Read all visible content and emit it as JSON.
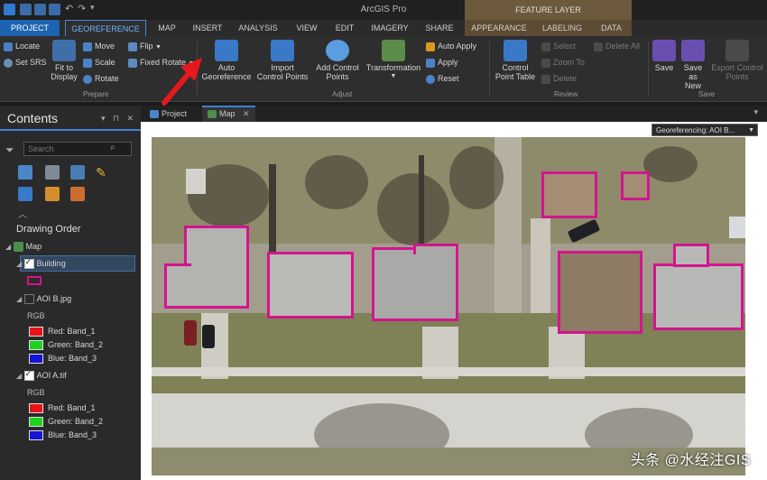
{
  "title_bar": {
    "app_title": "ArcGIS Pro",
    "context_header": "FEATURE LAYER"
  },
  "ribbon_tabs": [
    "PROJECT",
    "GEOREFERENCE",
    "MAP",
    "INSERT",
    "ANALYSIS",
    "VIEW",
    "EDIT",
    "IMAGERY",
    "SHARE",
    "APPEARANCE",
    "LABELING",
    "DATA"
  ],
  "ribbon": {
    "prepare": {
      "locate": "Locate",
      "set_srs": "Set SRS",
      "fit_to_display_l1": "Fit to",
      "fit_to_display_l2": "Display",
      "move": "Move",
      "scale": "Scale",
      "rotate": "Rotate",
      "flip": "Flip",
      "fixed_rotate": "Fixed Rotate",
      "group_label": "Prepare"
    },
    "adjust": {
      "auto_georeference_l1": "Auto",
      "auto_georeference_l2": "Georeference",
      "import_cp_l1": "Import",
      "import_cp_l2": "Control Points",
      "add_cp_l1": "Add Control",
      "add_cp_l2": "Points",
      "transformation": "Transformation",
      "auto_apply": "Auto Apply",
      "apply": "Apply",
      "reset": "Reset",
      "group_label": "Adjust"
    },
    "review": {
      "cp_table_l1": "Control",
      "cp_table_l2": "Point Table",
      "select": "Select",
      "zoom_to": "Zoom To",
      "delete": "Delete",
      "delete_all": "Delete All",
      "group_label": "Review"
    },
    "save": {
      "save": "Save",
      "save_as_new_l1": "Save as",
      "save_as_new_l2": "New",
      "export_cp_l1": "Export Control",
      "export_cp_l2": "Points",
      "group_label": "Save"
    }
  },
  "contents": {
    "title": "Contents",
    "search_placeholder": "Search",
    "drawing_order": "Drawing Order",
    "tree": {
      "map": "Map",
      "building": "Building",
      "aoi_b": "AOI B.jpg",
      "rgb1": "RGB",
      "red1": "Red: Band_1",
      "green1": "Green: Band_2",
      "blue1": "Blue: Band_3",
      "aoi_a": "AOI A.tif",
      "rgb2": "RGB",
      "red2": "Red: Band_1",
      "green2": "Green: Band_2",
      "blue2": "Blue: Band_3"
    }
  },
  "map_tabs": {
    "project": "Project",
    "map": "Map"
  },
  "map_view": {
    "georef_dropdown": "Georeferencing: AOI B..."
  },
  "watermark": "头条 @水经注GIS",
  "colors": {
    "accent": "#1e63b0",
    "building_outline": "#d4148f",
    "red_band": "#e8131a",
    "green_band": "#1fd11f",
    "blue_band": "#1515d6"
  }
}
